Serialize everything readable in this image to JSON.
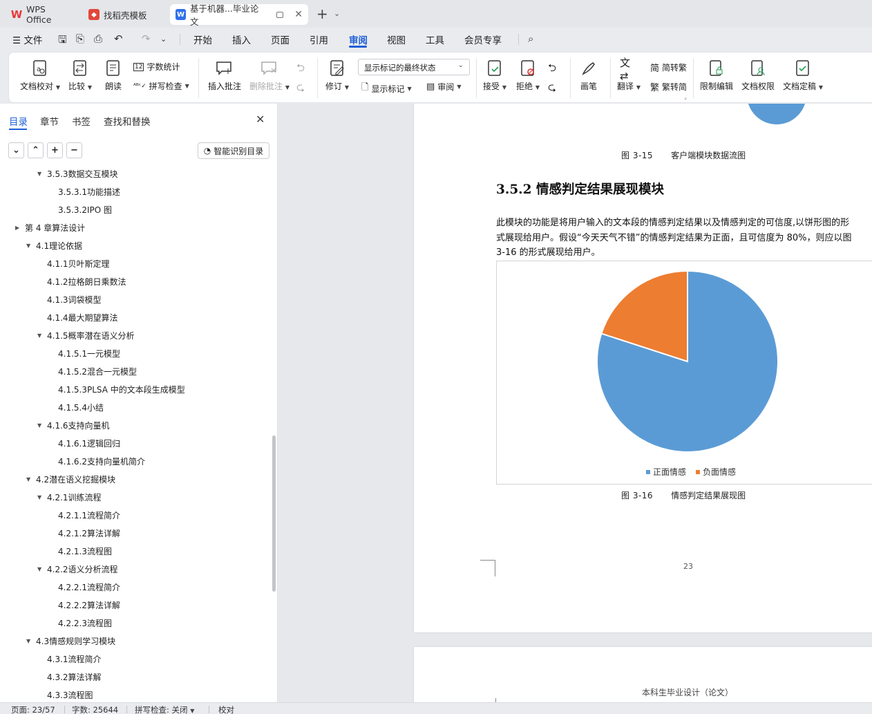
{
  "tabs": [
    {
      "label": "WPS Office",
      "icon": "wps-logo-icon"
    },
    {
      "label": "找稻壳模板",
      "icon": "daoke-logo-icon"
    },
    {
      "label": "基于机器...毕业论文",
      "icon": "word-doc-icon",
      "active": true
    }
  ],
  "menubar": {
    "file": "文件",
    "items": [
      "开始",
      "插入",
      "页面",
      "引用",
      "审阅",
      "视图",
      "工具",
      "会员专享"
    ],
    "active": "审阅"
  },
  "ribbon": {
    "doc_check": "文档校对",
    "compare": "比较",
    "read_aloud": "朗读",
    "word_count": "字数统计",
    "spell_check": "拼写检查",
    "insert_comment": "插入批注",
    "delete_comment": "删除批注",
    "track_changes": "修订",
    "markup_state": "显示标记的最终状态",
    "show_markup": "显示标记",
    "review": "审阅",
    "accept": "接受",
    "reject": "拒绝",
    "pen": "画笔",
    "translate": "翻译",
    "to_traditional": "简转繁",
    "to_simplified": "繁转简",
    "restrict_edit": "限制编辑",
    "doc_permission": "文档权限",
    "doc_finalize": "文档定稿"
  },
  "nav": {
    "tabs": [
      "目录",
      "章节",
      "书签",
      "查找和替换"
    ],
    "active_tab": "目录",
    "smart_toc": "智能识别目录",
    "toc": [
      {
        "label": "3.5.3数据交互模块",
        "level": 2,
        "arrow": "▼"
      },
      {
        "label": "3.5.3.1功能描述",
        "level": 3,
        "arrow": ""
      },
      {
        "label": "3.5.3.2IPO 图",
        "level": 3,
        "arrow": ""
      },
      {
        "label": "第 4 章算法设计",
        "level": 0,
        "arrow": "▶"
      },
      {
        "label": "4.1理论依据",
        "level": 1,
        "arrow": "▼"
      },
      {
        "label": "4.1.1贝叶斯定理",
        "level": 2,
        "arrow": ""
      },
      {
        "label": "4.1.2拉格朗日乘数法",
        "level": 2,
        "arrow": ""
      },
      {
        "label": "4.1.3词袋模型",
        "level": 2,
        "arrow": ""
      },
      {
        "label": "4.1.4最大期望算法",
        "level": 2,
        "arrow": ""
      },
      {
        "label": "4.1.5概率潜在语义分析",
        "level": 2,
        "arrow": "▼"
      },
      {
        "label": "4.1.5.1一元模型",
        "level": 3,
        "arrow": ""
      },
      {
        "label": "4.1.5.2混合一元模型",
        "level": 3,
        "arrow": ""
      },
      {
        "label": "4.1.5.3PLSA 中的文本段生成模型",
        "level": 3,
        "arrow": ""
      },
      {
        "label": "4.1.5.4小结",
        "level": 3,
        "arrow": ""
      },
      {
        "label": "4.1.6支持向量机",
        "level": 2,
        "arrow": "▼"
      },
      {
        "label": "4.1.6.1逻辑回归",
        "level": 3,
        "arrow": ""
      },
      {
        "label": "4.1.6.2支持向量机简介",
        "level": 3,
        "arrow": ""
      },
      {
        "label": "4.2潜在语义挖掘模块",
        "level": 1,
        "arrow": "▼"
      },
      {
        "label": "4.2.1训练流程",
        "level": 2,
        "arrow": "▼"
      },
      {
        "label": "4.2.1.1流程简介",
        "level": 3,
        "arrow": ""
      },
      {
        "label": "4.2.1.2算法详解",
        "level": 3,
        "arrow": ""
      },
      {
        "label": "4.2.1.3流程图",
        "level": 3,
        "arrow": ""
      },
      {
        "label": "4.2.2语义分析流程",
        "level": 2,
        "arrow": "▼"
      },
      {
        "label": "4.2.2.1流程简介",
        "level": 3,
        "arrow": ""
      },
      {
        "label": "4.2.2.2算法详解",
        "level": 3,
        "arrow": ""
      },
      {
        "label": "4.2.2.3流程图",
        "level": 3,
        "arrow": ""
      },
      {
        "label": "4.3情感规则学习模块",
        "level": 1,
        "arrow": "▼"
      },
      {
        "label": "4.3.1流程简介",
        "level": 2,
        "arrow": ""
      },
      {
        "label": "4.3.2算法详解",
        "level": 2,
        "arrow": ""
      },
      {
        "label": "4.3.3流程图",
        "level": 2,
        "arrow": ""
      }
    ]
  },
  "document": {
    "prev_caption_no": "图 3-15",
    "prev_caption": "客户端模块数据流图",
    "heading": "3.5.2 情感判定结果展现模块",
    "para_lines": [
      "此模块的功能是将用户输入的文本段的情感判定结果以及情感判定的可信度,以饼形图的形",
      "式展现给用户。假设“今天天气不错”的情感判定结果为正面，且可信度为 80%，则应以图",
      "3-16 的形式展现给用户。"
    ],
    "caption_no": "图 3-16",
    "caption": "情感判定结果展现图",
    "page_number": "23",
    "page2_header": "本科生毕业设计（论文）"
  },
  "chart_data": {
    "type": "pie",
    "categories": [
      "正面情感",
      "负面情感"
    ],
    "values": [
      80,
      20
    ],
    "colors": [
      "#5b9bd5",
      "#ed7d31"
    ],
    "legend": "bottom",
    "title": ""
  },
  "status": {
    "page": "页面: 23/57",
    "words": "字数: 25644",
    "spell": "拼写检查: 关闭",
    "proof": "校对"
  }
}
